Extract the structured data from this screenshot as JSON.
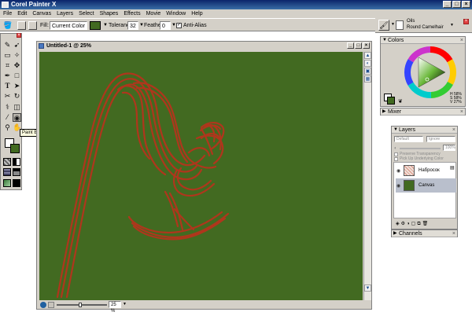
{
  "app": {
    "title": "Corel Painter X"
  },
  "menu": [
    "File",
    "Edit",
    "Canvas",
    "Layers",
    "Select",
    "Shapes",
    "Effects",
    "Movie",
    "Window",
    "Help"
  ],
  "property_bar": {
    "fill_label": "Fill:",
    "fill_value": "Current Color",
    "tolerance_label": "Tolerance:",
    "tolerance_value": "32",
    "feather_label": "Feather:",
    "feather_value": "0",
    "antialias_label": "Anti-Alias",
    "antialias_checked": true,
    "fill_swatch_color": "#426a21"
  },
  "brush_selector": {
    "category": "Oils",
    "variant": "Round Camelhair"
  },
  "toolbox": {
    "tooltip": "Paint Bucket",
    "main_color": "#ffffff",
    "secondary_color": "#426a21"
  },
  "document": {
    "title": "Untitled-1 @ 25%",
    "zoom": "25 %",
    "canvas_color": "#426a21",
    "stroke_color": "#b5341c"
  },
  "colors_panel": {
    "title": "Colors",
    "h_value": "H 58%",
    "s_value": "S 58%",
    "v_value": "V 27%",
    "current_color": "#426a21"
  },
  "mixer_panel": {
    "title": "Mixer"
  },
  "layers_panel": {
    "title": "Layers",
    "composite_method": "Default",
    "composite_depth": "Ignore",
    "opacity": "100%",
    "preserve_transparency": "Preserve Transparency",
    "pick_underlying": "Pick Up Underlying Color",
    "layers": [
      {
        "name": "Набросок",
        "selected": false,
        "thumb": "#e8d8d0"
      },
      {
        "name": "Canvas",
        "selected": true,
        "thumb": "#426a21"
      }
    ]
  },
  "channels_panel": {
    "title": "Channels"
  }
}
